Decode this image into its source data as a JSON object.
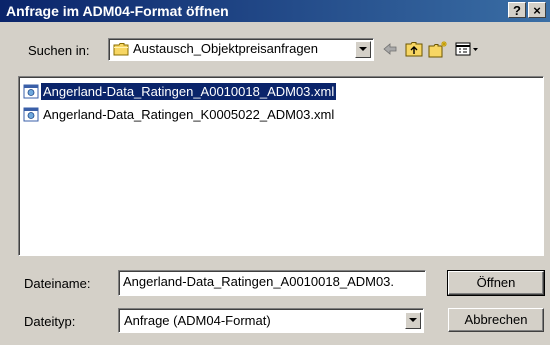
{
  "window": {
    "title": "Anfrage im ADM04-Format öffnen",
    "help_label": "?",
    "close_label": "×"
  },
  "lookin": {
    "label": "Suchen in:",
    "value": "Austausch_Objektpreisanfragen"
  },
  "toolbar": {
    "icons": [
      "back-arrow-icon",
      "up-folder-icon",
      "new-folder-icon",
      "view-menu-icon"
    ]
  },
  "files": [
    {
      "name": "Angerland-Data_Ratingen_A0010018_ADM03.xml",
      "selected": true
    },
    {
      "name": "Angerland-Data_Ratingen_K0005022_ADM03.xml",
      "selected": false
    }
  ],
  "filename": {
    "label": "Dateiname:",
    "value": "Angerland-Data_Ratingen_A0010018_ADM03."
  },
  "filetype": {
    "label": "Dateityp:",
    "value": "Anfrage (ADM04-Format)"
  },
  "buttons": {
    "open_label": "Öffnen",
    "cancel_label": "Abbrechen"
  },
  "colors": {
    "title_start": "#0a246a",
    "title_end": "#3a6ea5",
    "selection": "#0a246a",
    "window_bg": "#d4d0c8"
  }
}
